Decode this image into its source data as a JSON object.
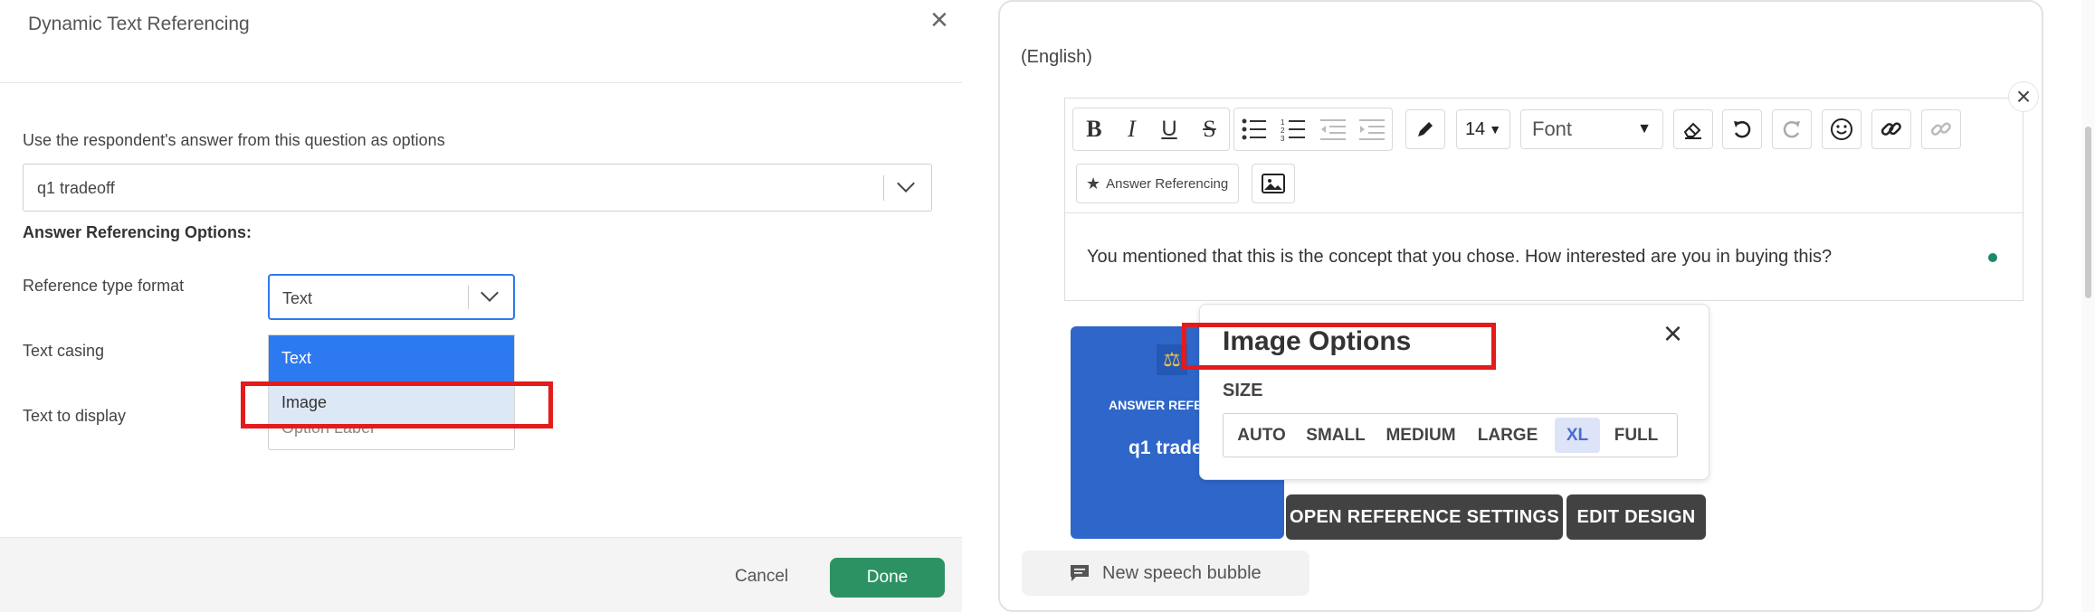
{
  "modal": {
    "title": "Dynamic Text Referencing",
    "close_icon": "×",
    "question_label": "Use the respondent's answer from this question as options",
    "question_value": "q1 tradeoff",
    "options_heading": "Answer Referencing Options:",
    "ref_type_label": "Reference type format",
    "ref_type_value": "Text",
    "text_casing_label": "Text casing",
    "text_display_label": "Text to display",
    "text_display_value": "Option Label",
    "dropdown_options": [
      "Text",
      "Image"
    ],
    "cancel_label": "Cancel",
    "done_label": "Done",
    "colors": {
      "done": "#2d9263",
      "selected_option": "#2d79f0",
      "hover_option": "#dde8f7",
      "highlight": "#e31b1b"
    }
  },
  "editor": {
    "language": "(English)",
    "close_icon": "×",
    "font_size": "14",
    "font_name": "Font",
    "answer_ref_label": "Answer Referencing",
    "body_text": "You mentioned that this is the concept that you chose. How interested are you in buying this?",
    "card_label": "ANSWER REFE",
    "card_value": "q1 trade",
    "open_ref_btn": "OPEN REFERENCE SETTINGS",
    "edit_design_btn": "EDIT DESIGN",
    "speech_bubble_label": "New speech bubble",
    "icons": [
      "bold-icon",
      "italic-icon",
      "underline-icon",
      "strikethrough-icon",
      "bullet-list-icon",
      "numbered-list-icon",
      "outdent-icon",
      "indent-icon",
      "pen-icon",
      "eraser-icon",
      "undo-icon",
      "redo-icon",
      "emoji-icon",
      "link-icon",
      "unlink-icon",
      "star-icon",
      "image-icon",
      "speech-bubble-icon"
    ],
    "colors": {
      "card": "#2f66c9",
      "action_btn": "#424242"
    }
  },
  "image_options": {
    "title": "Image Options",
    "size_label": "SIZE",
    "close_icon": "×",
    "sizes": [
      "AUTO",
      "SMALL",
      "MEDIUM",
      "LARGE",
      "XL",
      "FULL"
    ],
    "selected": "XL"
  }
}
